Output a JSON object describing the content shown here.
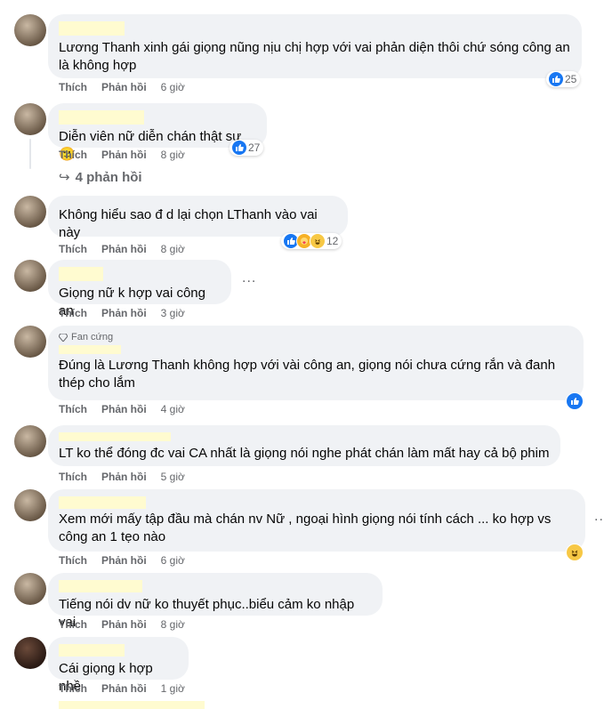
{
  "actions": {
    "like": "Thích",
    "reply": "Phản hồi"
  },
  "comments": [
    {
      "text": "Lương Thanh xinh gái giọng nũng nịu chị hợp với vai phản diện thôi chứ sóng công an là không hợp",
      "time": "6 giờ",
      "reaction_count": "25",
      "reactions": [
        "like"
      ]
    },
    {
      "text": "Diễn viên nữ diễn chán thật sự 🙂",
      "time": "8 giờ",
      "reaction_count": "27",
      "reactions": [
        "like"
      ],
      "replies_label": "4 phản hồi"
    },
    {
      "text": "Không hiểu sao đ d lại chọn LThanh vào vai này",
      "time": "8 giờ",
      "reaction_count": "12",
      "reactions": [
        "like",
        "care",
        "haha"
      ]
    },
    {
      "text": "Giọng nữ k hợp vai công an",
      "time": "3 giờ"
    },
    {
      "badge": "Fan cứng",
      "text": "Đúng là Lương Thanh không hợp với vài công an, giọng nói chưa cứng rắn và đanh thép cho lắm",
      "time": "4 giờ",
      "reactions": [
        "like"
      ]
    },
    {
      "text": "LT ko thể đóng đc vai CA nhất là giọng nói nghe phát chán làm mất hay cả bộ phim",
      "time": "5 giờ"
    },
    {
      "text": "Xem mới mấy tập đầu mà chán nv Nữ , ngoại hình giọng nói tính cách ... ko hợp vs công an 1 tẹo nào",
      "time": "6 giờ",
      "reactions": [
        "haha"
      ]
    },
    {
      "text": "Tiếng nói dv nữ ko thuyết phục..biểu cảm ko nhập vai",
      "time": "8 giờ"
    },
    {
      "text": "Cái giọng k hợp nhề",
      "time": "1 giờ"
    }
  ],
  "more_label": "...",
  "colors": {
    "like": "#1877f2",
    "bubble": "#f0f2f5",
    "meta": "#65676b",
    "redaction": "#fffbd0"
  }
}
